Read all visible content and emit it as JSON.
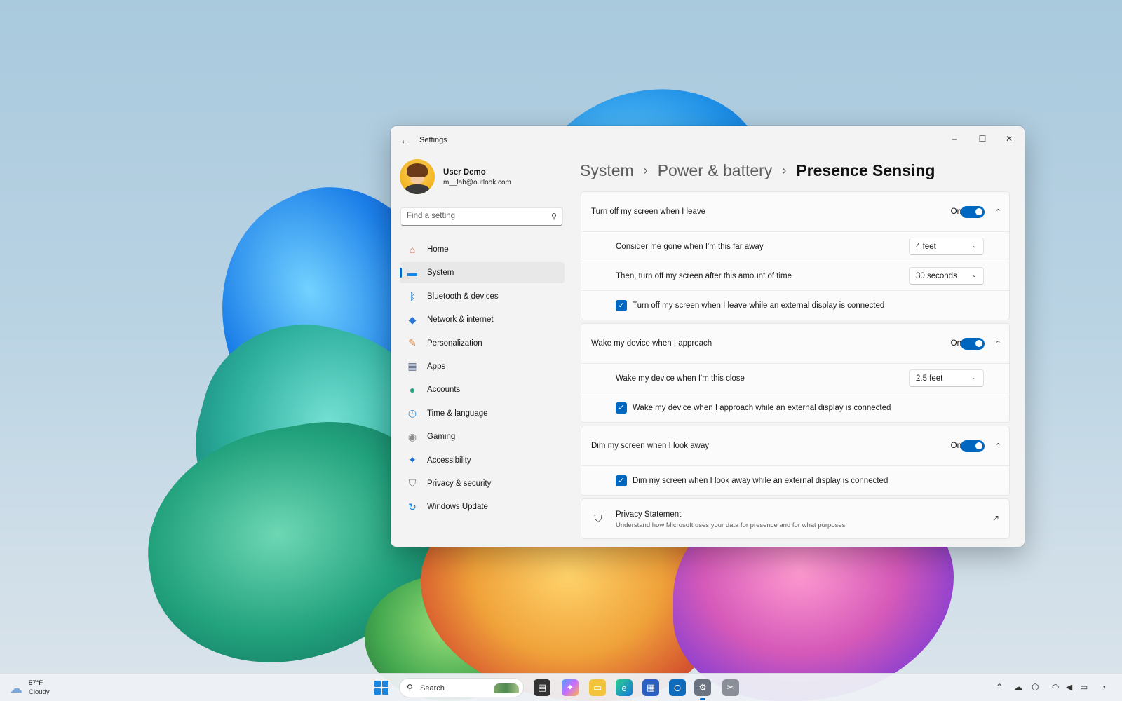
{
  "window": {
    "title": "Settings",
    "back_icon": "back-arrow-icon",
    "controls": {
      "minimize": "–",
      "maximize": "☐",
      "close": "✕"
    }
  },
  "profile": {
    "name": "User Demo",
    "email": "m__lab@outlook.com"
  },
  "search": {
    "placeholder": "Find a setting",
    "value": ""
  },
  "sidebar": {
    "items": [
      {
        "label": "Home",
        "icon": "house-icon",
        "glyph": "⌂",
        "color": "#d26a4a"
      },
      {
        "label": "System",
        "icon": "monitor-icon",
        "glyph": "▬",
        "color": "#1587e6",
        "active": true
      },
      {
        "label": "Bluetooth & devices",
        "icon": "bluetooth-icon",
        "glyph": "ᛒ",
        "color": "#1a7fe0"
      },
      {
        "label": "Network & internet",
        "icon": "wifi-icon",
        "glyph": "◆",
        "color": "#2a79d8"
      },
      {
        "label": "Personalization",
        "icon": "brush-icon",
        "glyph": "✎",
        "color": "#e08a3c"
      },
      {
        "label": "Apps",
        "icon": "apps-icon",
        "glyph": "▦",
        "color": "#5a6a8a"
      },
      {
        "label": "Accounts",
        "icon": "person-icon",
        "glyph": "●",
        "color": "#2aa383"
      },
      {
        "label": "Time & language",
        "icon": "globe-clock-icon",
        "glyph": "◷",
        "color": "#3a8fd8"
      },
      {
        "label": "Gaming",
        "icon": "gamepad-icon",
        "glyph": "◉",
        "color": "#8a8a8a"
      },
      {
        "label": "Accessibility",
        "icon": "accessibility-icon",
        "glyph": "✦",
        "color": "#1a6fd0"
      },
      {
        "label": "Privacy & security",
        "icon": "shield-icon",
        "glyph": "⛉",
        "color": "#7a7a7a"
      },
      {
        "label": "Windows Update",
        "icon": "update-icon",
        "glyph": "↻",
        "color": "#1a7fe0"
      }
    ]
  },
  "breadcrumb": {
    "items": [
      "System",
      "Power & battery",
      "Presence Sensing"
    ],
    "separator": "›"
  },
  "sections": {
    "leave": {
      "label": "Turn off my screen when I leave",
      "toggle_state": "On",
      "distance_label": "Consider me gone when I'm this far away",
      "distance_value": "4 feet",
      "timeout_label": "Then, turn off my screen after this amount of time",
      "timeout_value": "30 seconds",
      "external_label": "Turn off my screen when I leave while an external display is connected"
    },
    "approach": {
      "label": "Wake my device when I approach",
      "toggle_state": "On",
      "distance_label": "Wake my device when I'm this close",
      "distance_value": "2.5 feet",
      "external_label": "Wake my device when I approach while an external display is connected"
    },
    "dim": {
      "label": "Dim my screen when I look away",
      "toggle_state": "On",
      "external_label": "Dim my screen when I look away while an external display is connected"
    },
    "privacy": {
      "title": "Privacy Statement",
      "subtitle": "Understand how Microsoft uses your data for presence and for what purposes"
    }
  },
  "taskbar": {
    "weather_temp": "57°F",
    "weather_desc": "Cloudy",
    "search_label": "Search",
    "accent": "#0067c0"
  }
}
